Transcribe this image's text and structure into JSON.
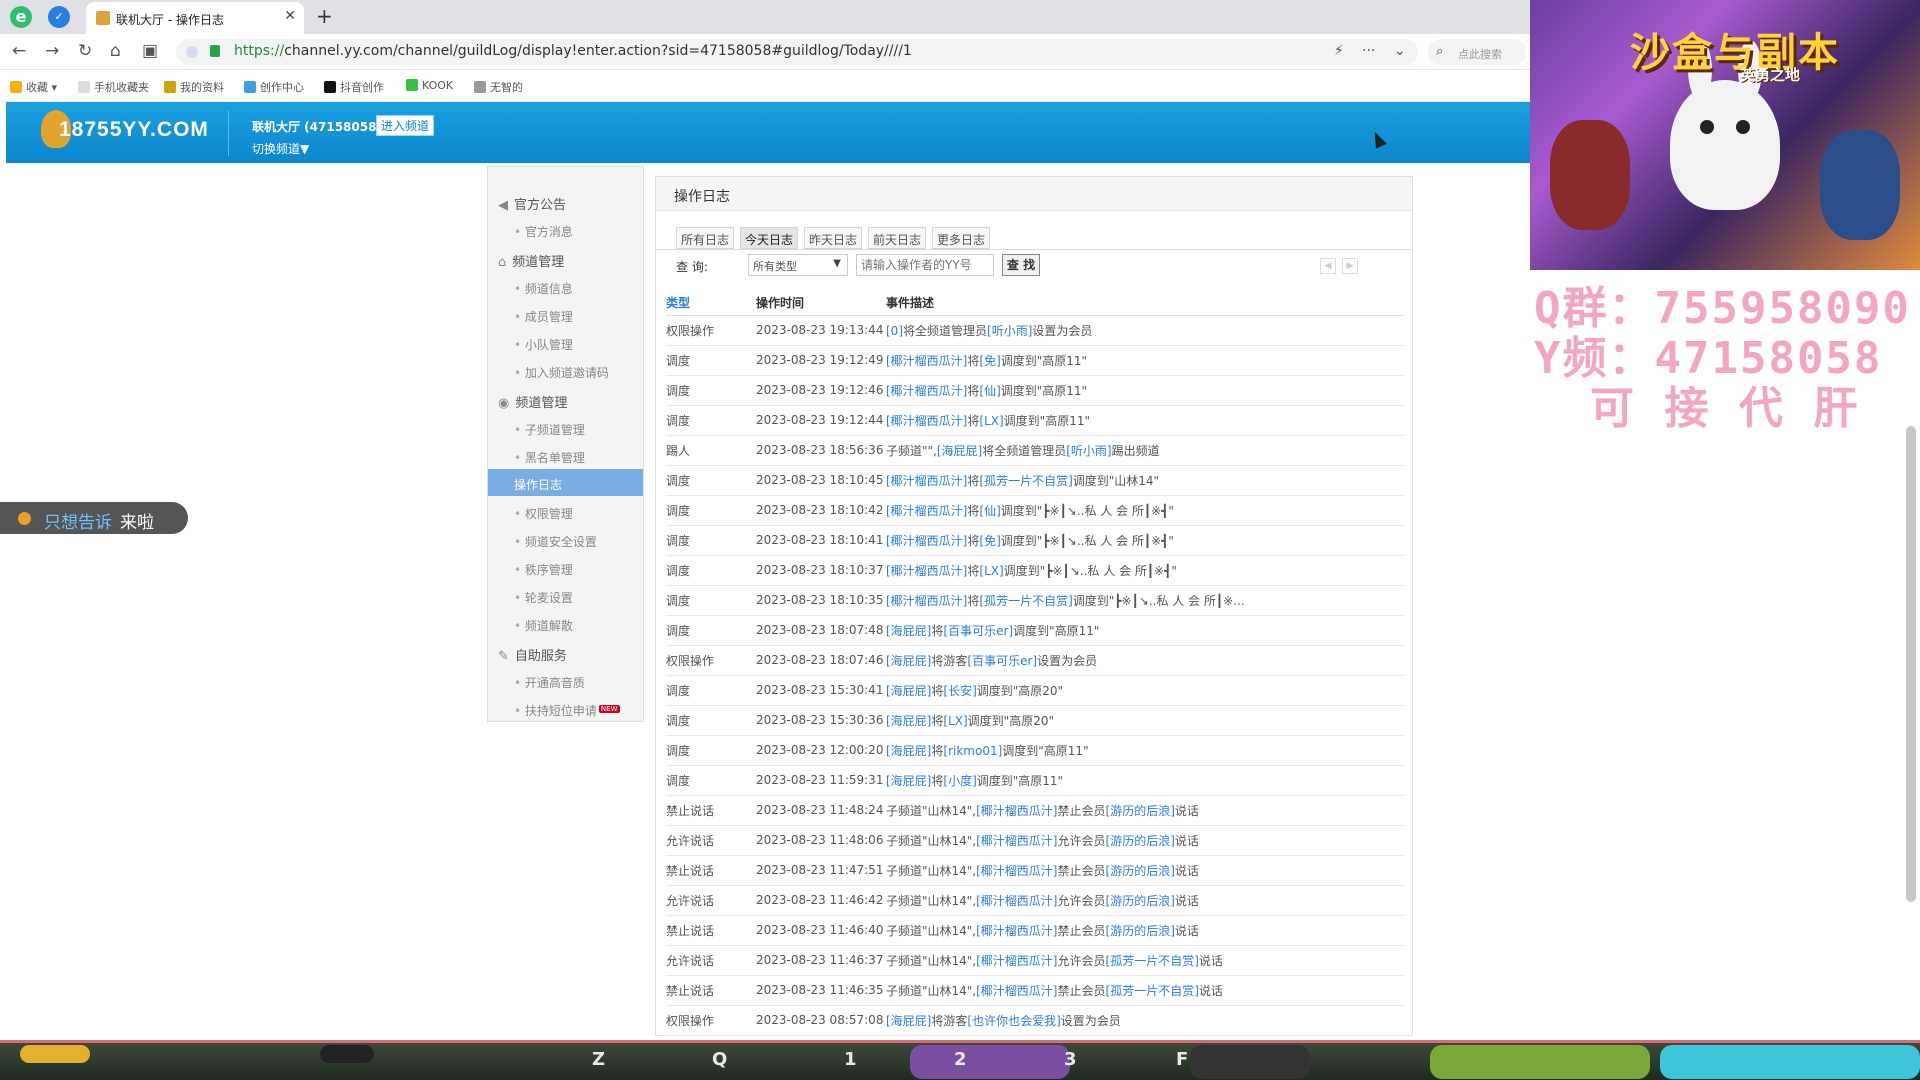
{
  "browser": {
    "tab_title": "联机大厅 - 操作日志",
    "url_scheme": "https://",
    "url_rest": "channel.yy.com/channel/guildLog/display!enter.action?sid=47158058#guildlog/Today////1",
    "search_placeholder": "点此搜索",
    "bookmarks": [
      "收藏",
      "手机收藏夹",
      "我的资料",
      "创作中心",
      "抖音创作",
      "KOOK",
      "无智的"
    ]
  },
  "header": {
    "logo_text": "18755YY.COM",
    "channel_name": "联机大厅 (47158058)",
    "enter_channel": "进入频道",
    "switch_channel": "切换频道▼"
  },
  "sidebar": {
    "sections": [
      {
        "title": "官方公告",
        "icon": "speaker-icon",
        "items": [
          "官方消息"
        ]
      },
      {
        "title": "频道管理",
        "icon": "home-icon",
        "items": [
          "频道信息",
          "成员管理",
          "小队管理",
          "加入频道邀请码"
        ]
      },
      {
        "title": "频道管理",
        "icon": "shield-icon",
        "items": [
          "子频道管理",
          "黑名单管理",
          "操作日志",
          "权限管理",
          "频道安全设置",
          "秩序管理",
          "轮麦设置",
          "频道解散"
        ]
      },
      {
        "title": "自助服务",
        "icon": "wrench-icon",
        "items": [
          "开通高音质",
          "扶持短位申请"
        ]
      }
    ],
    "new_badge": "NEW"
  },
  "main": {
    "title": "操作日志",
    "tabs": [
      "所有日志",
      "今天日志",
      "昨天日志",
      "前天日志",
      "更多日志"
    ],
    "active_tab": "今天日志",
    "query_label": "查  询:",
    "type_select_value": "所有类型",
    "operator_placeholder": "请输入操作者的YY号",
    "search_button": "查 找",
    "columns": [
      "类型",
      "操作时间",
      "事件描述"
    ],
    "rows": [
      {
        "type": "权限操作",
        "time": "2023-08-23 19:13:44",
        "desc": [
          [
            "[0]",
            "l"
          ],
          [
            "将全频道管理员",
            ""
          ],
          [
            "[听小雨]",
            "l"
          ],
          [
            "设置为会员",
            ""
          ]
        ]
      },
      {
        "type": "调度",
        "time": "2023-08-23 19:12:49",
        "desc": [
          [
            "[椰汁榴西瓜汁]",
            "l"
          ],
          [
            "将",
            ""
          ],
          [
            "[免]",
            "l"
          ],
          [
            "调度到\"高原11\"",
            ""
          ]
        ]
      },
      {
        "type": "调度",
        "time": "2023-08-23 19:12:46",
        "desc": [
          [
            "[椰汁榴西瓜汁]",
            "l"
          ],
          [
            "将",
            ""
          ],
          [
            "[仙]",
            "l"
          ],
          [
            "调度到\"高原11\"",
            ""
          ]
        ]
      },
      {
        "type": "调度",
        "time": "2023-08-23 19:12:44",
        "desc": [
          [
            "[椰汁榴西瓜汁]",
            "l"
          ],
          [
            "将",
            ""
          ],
          [
            "[LX]",
            "l"
          ],
          [
            "调度到\"高原11\"",
            ""
          ]
        ]
      },
      {
        "type": "踢人",
        "time": "2023-08-23 18:56:36",
        "desc": [
          [
            "子频道\"\",",
            ""
          ],
          [
            "[海屁屁]",
            "l"
          ],
          [
            "将全频道管理员",
            ""
          ],
          [
            "[听小雨]",
            "l"
          ],
          [
            "踢出频道",
            ""
          ]
        ]
      },
      {
        "type": "调度",
        "time": "2023-08-23 18:10:45",
        "desc": [
          [
            "[椰汁榴西瓜汁]",
            "l"
          ],
          [
            "将",
            ""
          ],
          [
            "[孤芳一片不自赏]",
            "l"
          ],
          [
            "调度到\"山林14\"",
            ""
          ]
        ]
      },
      {
        "type": "调度",
        "time": "2023-08-23 18:10:42",
        "desc": [
          [
            "[椰汁榴西瓜汁]",
            "l"
          ],
          [
            "将",
            ""
          ],
          [
            "[仙]",
            "l"
          ],
          [
            "调度到\"┣※┃↘..私 人 会 所┃※┫\"",
            ""
          ]
        ]
      },
      {
        "type": "调度",
        "time": "2023-08-23 18:10:41",
        "desc": [
          [
            "[椰汁榴西瓜汁]",
            "l"
          ],
          [
            "将",
            ""
          ],
          [
            "[免]",
            "l"
          ],
          [
            "调度到\"┣※┃↘..私 人 会 所┃※┫\"",
            ""
          ]
        ]
      },
      {
        "type": "调度",
        "time": "2023-08-23 18:10:37",
        "desc": [
          [
            "[椰汁榴西瓜汁]",
            "l"
          ],
          [
            "将",
            ""
          ],
          [
            "[LX]",
            "l"
          ],
          [
            "调度到\"┣※┃↘..私 人 会 所┃※┫\"",
            ""
          ]
        ]
      },
      {
        "type": "调度",
        "time": "2023-08-23 18:10:35",
        "desc": [
          [
            "[椰汁榴西瓜汁]",
            "l"
          ],
          [
            "将",
            ""
          ],
          [
            "[孤芳一片不自赏]",
            "l"
          ],
          [
            "调度到\"┣※┃↘..私 人 会 所┃※...",
            ""
          ]
        ]
      },
      {
        "type": "调度",
        "time": "2023-08-23 18:07:48",
        "desc": [
          [
            "[海屁屁]",
            "l"
          ],
          [
            "将",
            ""
          ],
          [
            "[百事可乐er]",
            "l"
          ],
          [
            "调度到\"高原11\"",
            ""
          ]
        ]
      },
      {
        "type": "权限操作",
        "time": "2023-08-23 18:07:46",
        "desc": [
          [
            "[海屁屁]",
            "l"
          ],
          [
            "将游客",
            ""
          ],
          [
            "[百事可乐er]",
            "l"
          ],
          [
            "设置为会员",
            ""
          ]
        ]
      },
      {
        "type": "调度",
        "time": "2023-08-23 15:30:41",
        "desc": [
          [
            "[海屁屁]",
            "l"
          ],
          [
            "将",
            ""
          ],
          [
            "[长安]",
            "l"
          ],
          [
            "调度到\"高原20\"",
            ""
          ]
        ]
      },
      {
        "type": "调度",
        "time": "2023-08-23 15:30:36",
        "desc": [
          [
            "[海屁屁]",
            "l"
          ],
          [
            "将",
            ""
          ],
          [
            "[LX]",
            "l"
          ],
          [
            "调度到\"高原20\"",
            ""
          ]
        ]
      },
      {
        "type": "调度",
        "time": "2023-08-23 12:00:20",
        "desc": [
          [
            "[海屁屁]",
            "l"
          ],
          [
            "将",
            ""
          ],
          [
            "[rikmo01]",
            "l"
          ],
          [
            "调度到\"高原11\"",
            ""
          ]
        ]
      },
      {
        "type": "调度",
        "time": "2023-08-23 11:59:31",
        "desc": [
          [
            "[海屁屁]",
            "l"
          ],
          [
            "将",
            ""
          ],
          [
            "[小度]",
            "l"
          ],
          [
            "调度到\"高原11\"",
            ""
          ]
        ]
      },
      {
        "type": "禁止说话",
        "time": "2023-08-23 11:48:24",
        "desc": [
          [
            "子频道\"山林14\",",
            ""
          ],
          [
            "[椰汁榴西瓜汁]",
            "l"
          ],
          [
            "禁止会员",
            ""
          ],
          [
            "[游历的后浪]",
            "l"
          ],
          [
            "说话",
            ""
          ]
        ]
      },
      {
        "type": "允许说话",
        "time": "2023-08-23 11:48:06",
        "desc": [
          [
            "子频道\"山林14\",",
            ""
          ],
          [
            "[椰汁榴西瓜汁]",
            "l"
          ],
          [
            "允许会员",
            ""
          ],
          [
            "[游历的后浪]",
            "l"
          ],
          [
            "说话",
            ""
          ]
        ]
      },
      {
        "type": "禁止说话",
        "time": "2023-08-23 11:47:51",
        "desc": [
          [
            "子频道\"山林14\",",
            ""
          ],
          [
            "[椰汁榴西瓜汁]",
            "l"
          ],
          [
            "禁止会员",
            ""
          ],
          [
            "[游历的后浪]",
            "l"
          ],
          [
            "说话",
            ""
          ]
        ]
      },
      {
        "type": "允许说话",
        "time": "2023-08-23 11:46:42",
        "desc": [
          [
            "子频道\"山林14\",",
            ""
          ],
          [
            "[椰汁榴西瓜汁]",
            "l"
          ],
          [
            "允许会员",
            ""
          ],
          [
            "[游历的后浪]",
            "l"
          ],
          [
            "说话",
            ""
          ]
        ]
      },
      {
        "type": "禁止说话",
        "time": "2023-08-23 11:46:40",
        "desc": [
          [
            "子频道\"山林14\",",
            ""
          ],
          [
            "[椰汁榴西瓜汁]",
            "l"
          ],
          [
            "禁止会员",
            ""
          ],
          [
            "[游历的后浪]",
            "l"
          ],
          [
            "说话",
            ""
          ]
        ]
      },
      {
        "type": "允许说话",
        "time": "2023-08-23 11:46:37",
        "desc": [
          [
            "子频道\"山林14\",",
            ""
          ],
          [
            "[椰汁榴西瓜汁]",
            "l"
          ],
          [
            "允许会员",
            ""
          ],
          [
            "[孤芳一片不自赏]",
            "l"
          ],
          [
            "说话",
            ""
          ]
        ]
      },
      {
        "type": "禁止说话",
        "time": "2023-08-23 11:46:35",
        "desc": [
          [
            "子频道\"山林14\",",
            ""
          ],
          [
            "[椰汁榴西瓜汁]",
            "l"
          ],
          [
            "禁止会员",
            ""
          ],
          [
            "[孤芳一片不自赏]",
            "l"
          ],
          [
            "说话",
            ""
          ]
        ]
      },
      {
        "type": "权限操作",
        "time": "2023-08-23 08:57:08",
        "desc": [
          [
            "[海屁屁]",
            "l"
          ],
          [
            "将游客",
            ""
          ],
          [
            "[也许你也会爱我]",
            "l"
          ],
          [
            "设置为会员",
            ""
          ]
        ]
      }
    ]
  },
  "floating_bubble": {
    "text1": "只想告诉",
    "text2": "来啦"
  },
  "overlay": {
    "game_title": "沙盒与副本",
    "game_subtitle": "英勇之地",
    "promo_lines": [
      "Q群：755958090",
      "Y频：47158058",
      "可 接 代 肝"
    ]
  },
  "hud": {
    "keys": [
      "Z",
      "Q",
      "1",
      "2",
      "3",
      "F"
    ]
  },
  "colors": {
    "header_blue": "#1aa0e0",
    "link_blue": "#2a7de1",
    "sidebar_active": "#7aaee3",
    "promo_pink": "#f3a6c4"
  }
}
